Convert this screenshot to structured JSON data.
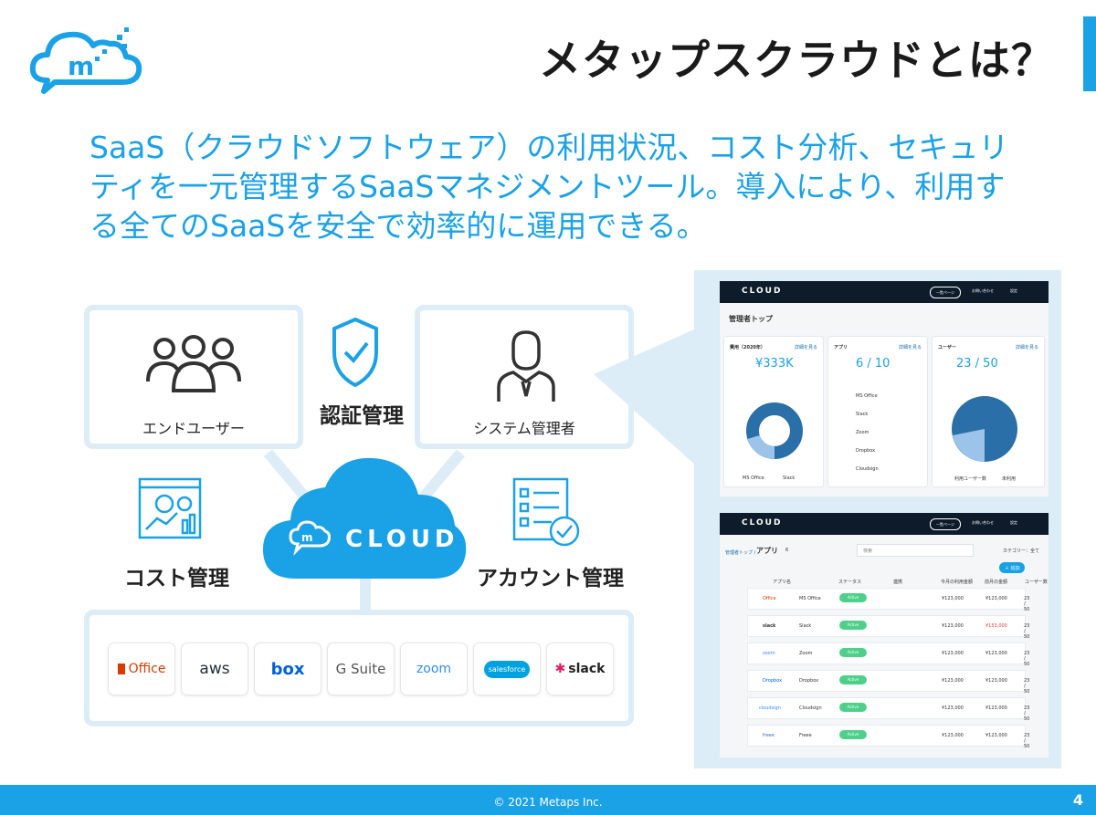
{
  "header": {
    "title": "メタップスクラウドとは？"
  },
  "intro_text": "SaaS（クラウドソフトウェア）の利用状況、コスト分析、セキュリティを一元管理するSaaSマネジメントツール。導入により、利用する全てのSaaSを安全で効率的に運用できる。",
  "diagram": {
    "end_user": "エンドユーザー",
    "system_admin": "システム管理者",
    "auth": "認証管理",
    "cost": "コスト管理",
    "account": "アカウント管理",
    "cloud": "CLOUD",
    "services": [
      "Office",
      "aws",
      "box",
      "G Suite",
      "zoom",
      "salesforce",
      "slack"
    ]
  },
  "screenshot_top": {
    "brand": "CLOUD",
    "nav": [
      "一覧ページ",
      "お問い合わせ",
      "設定"
    ],
    "page_title": "管理者トップ",
    "cost_card": {
      "title": "費用（2020年）",
      "link": "詳細を見る",
      "value": "¥333K",
      "legend": [
        "MS Office",
        "Slack"
      ]
    },
    "app_card": {
      "title": "アプリ",
      "link": "詳細を見る",
      "value": "6 / 10",
      "apps": [
        "MS Office",
        "Slack",
        "Zoom",
        "Dropbox",
        "Cloudsign"
      ]
    },
    "user_card": {
      "title": "ユーザー",
      "link": "詳細を見る",
      "value": "23 / 50",
      "legend": [
        "利用ユーザー数",
        "未利用"
      ]
    }
  },
  "screenshot_bottom": {
    "brand": "CLOUD",
    "nav": [
      "一覧ページ",
      "お問い合わせ",
      "設定"
    ],
    "breadcrumb": "管理者トップ /",
    "page_title": "アプリ",
    "count": "6",
    "search_placeholder": "検索",
    "category": "カテゴリー：全て",
    "add_button": "＋ 追加",
    "columns": [
      "アプリ名",
      "ステータス",
      "連携",
      "今月の利用金額",
      "前月の金額",
      "ユーザー数"
    ],
    "rows": [
      {
        "logo": "Office",
        "name": "MS Office",
        "status": "Active",
        "price": "¥123,000",
        "prev": "¥123,000",
        "users": "23 / 50"
      },
      {
        "logo": "slack",
        "name": "Slack",
        "status": "Active",
        "price": "¥123,000",
        "prev": "¥153,000",
        "users": "23 / 50"
      },
      {
        "logo": "zoom",
        "name": "Zoom",
        "status": "Active",
        "price": "¥123,000",
        "prev": "¥123,000",
        "users": "23 / 50"
      },
      {
        "logo": "Dropbox",
        "name": "Dropbox",
        "status": "Active",
        "price": "¥123,000",
        "prev": "¥123,000",
        "users": "23 / 50"
      },
      {
        "logo": "cloudsign",
        "name": "Cloudsign",
        "status": "Active",
        "price": "¥123,000",
        "prev": "¥123,000",
        "users": "23 / 50"
      },
      {
        "logo": "freee",
        "name": "Freee",
        "status": "Active",
        "price": "¥123,000",
        "prev": "¥123,000",
        "users": "23 / 50"
      }
    ]
  },
  "footer": {
    "copyright": "© 2021 Metaps Inc.",
    "page": "4"
  },
  "colors": {
    "accent": "#1aa1e6",
    "panel_border": "#dcedf8",
    "dark_nav": "#0d1b2a"
  }
}
